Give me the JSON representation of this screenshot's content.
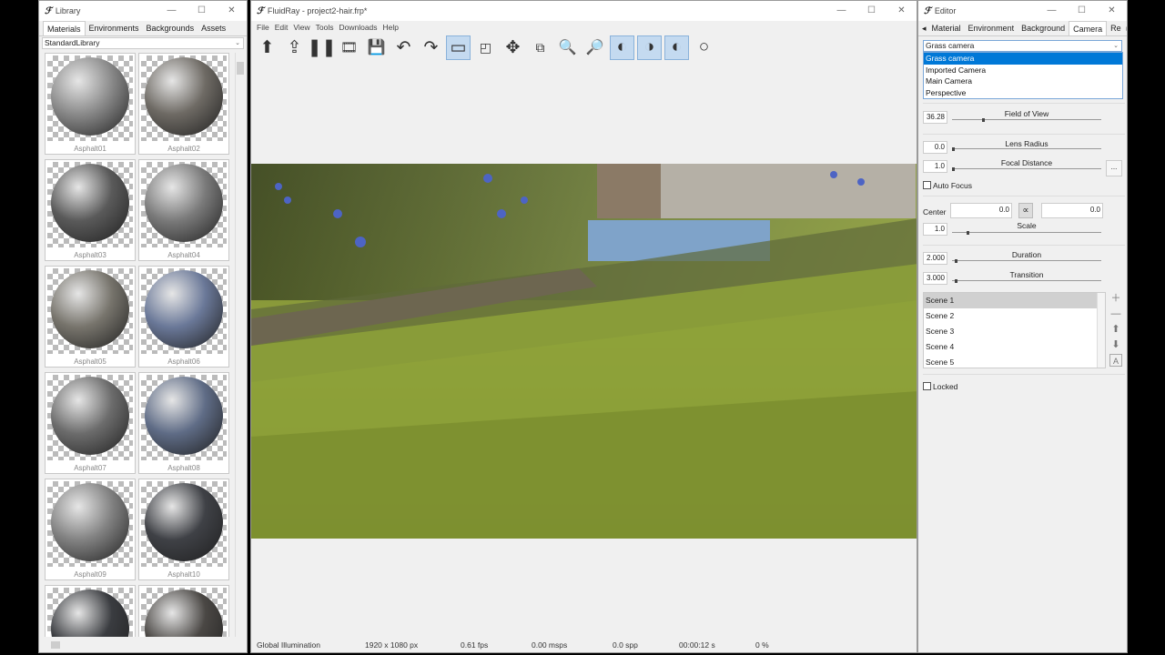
{
  "library": {
    "title": "Library",
    "tabs": [
      "Materials",
      "Environments",
      "Backgrounds",
      "Assets"
    ],
    "library_select": "StandardLibrary",
    "materials": [
      {
        "name": "Asphalt01",
        "color": "#8a8a8a"
      },
      {
        "name": "Asphalt02",
        "color": "#6e6a64"
      },
      {
        "name": "Asphalt03",
        "color": "#5a5a5a"
      },
      {
        "name": "Asphalt04",
        "color": "#7a7a7a"
      },
      {
        "name": "Asphalt05",
        "color": "#77746c"
      },
      {
        "name": "Asphalt06",
        "color": "#6a7898"
      },
      {
        "name": "Asphalt07",
        "color": "#6c6c6c"
      },
      {
        "name": "Asphalt08",
        "color": "#5f6c86"
      },
      {
        "name": "Asphalt09",
        "color": "#828282"
      },
      {
        "name": "Asphalt10",
        "color": "#3f4146"
      },
      {
        "name": "",
        "color": "#3a3c40"
      },
      {
        "name": "",
        "color": "#4a4744"
      }
    ]
  },
  "main": {
    "title": "FluidRay - project2-hair.frp*",
    "menu": [
      "File",
      "Edit",
      "View",
      "Tools",
      "Downloads",
      "Help"
    ],
    "status": {
      "mode": "Global Illumination",
      "resolution": "1920 x 1080 px",
      "fps": "0.61 fps",
      "msps": "0.00 msps",
      "spp": "0.0 spp",
      "time": "00:00:12 s",
      "progress": "0 %"
    }
  },
  "editor": {
    "title": "Editor",
    "tabs": [
      "Environment",
      "Background",
      "Camera",
      "Re"
    ],
    "camera_select": "Grass camera",
    "camera_options": [
      "Grass camera",
      "Imported Camera",
      "Main Camera",
      "Perspective"
    ],
    "field_of_view": {
      "label": "Field of View",
      "value": "36.28",
      "level": 0.2
    },
    "lens_radius": {
      "label": "Lens Radius",
      "value": "0.0",
      "level": 0.0
    },
    "focal_distance": {
      "label": "Focal Distance",
      "value": "1.0",
      "level": 0.0
    },
    "auto_focus": "Auto Focus",
    "center_label": "Center",
    "center_x": "0.0",
    "center_y": "0.0",
    "scale": {
      "label": "Scale",
      "value": "1.0",
      "level": 0.1
    },
    "duration": {
      "label": "Duration",
      "value": "2.000",
      "level": 0.02
    },
    "transition": {
      "label": "Transition",
      "value": "3.000",
      "level": 0.02
    },
    "scenes": [
      "Scene 1",
      "Scene 2",
      "Scene 3",
      "Scene 4",
      "Scene 5"
    ],
    "locked": "Locked",
    "more": "..."
  }
}
